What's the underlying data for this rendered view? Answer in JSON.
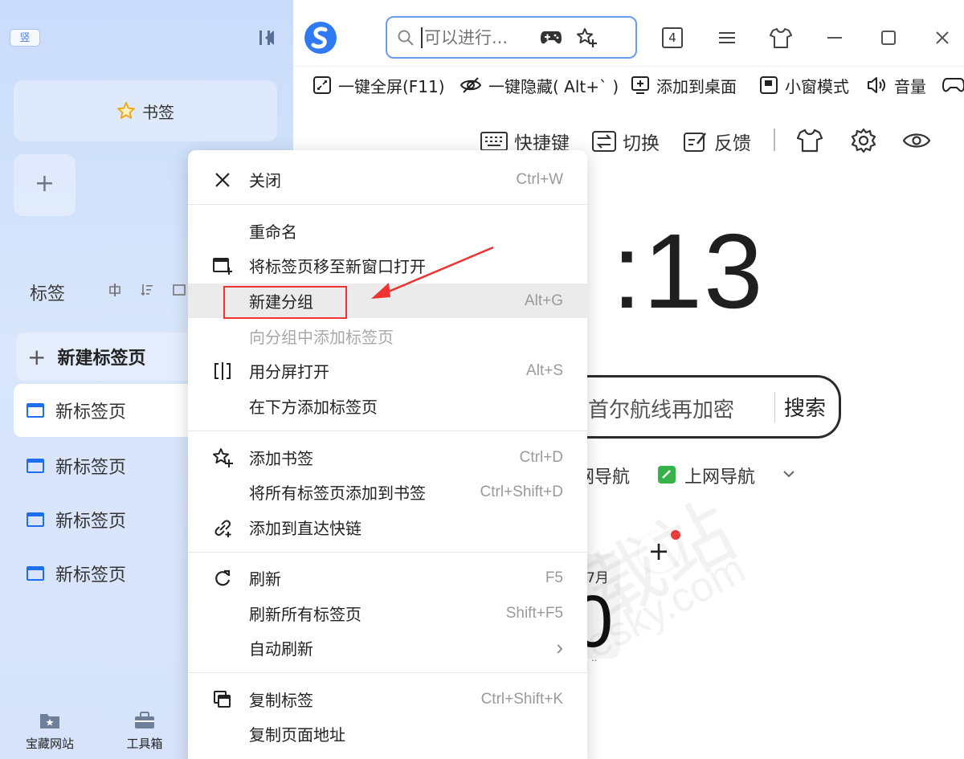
{
  "sidebar": {
    "vertical_tabs_badge": "竖",
    "bookmarks_label": "书签",
    "add_group_label": "+",
    "tabs_label": "标签",
    "new_tab_label": "新建标签页",
    "tabs": [
      {
        "title": "新标签页",
        "active": true
      },
      {
        "title": "新标签页",
        "active": false
      },
      {
        "title": "新标签页",
        "active": false
      },
      {
        "title": "新标签页",
        "active": false
      }
    ],
    "bottom": [
      {
        "label": "宝藏网站",
        "icon": "folder-star-icon"
      },
      {
        "label": "工具箱",
        "icon": "toolbox-icon"
      }
    ]
  },
  "topbar": {
    "search_placeholder": "可以进行...",
    "tab_count": "4"
  },
  "toolbar2": [
    {
      "label": "一键全屏(F11)",
      "icon": "fullscreen-icon"
    },
    {
      "label": "一键隐藏( Alt+` )",
      "icon": "hide-eye-icon"
    },
    {
      "label": "添加到桌面",
      "icon": "add-desktop-icon"
    },
    {
      "label": "小窗模式",
      "icon": "mini-window-icon"
    },
    {
      "label": "音量",
      "icon": "volume-icon"
    }
  ],
  "toolbar3": [
    {
      "label": "快捷键",
      "icon": "keyboard-icon"
    },
    {
      "label": "切换",
      "icon": "switch-icon"
    },
    {
      "label": "反馈",
      "icon": "feedback-icon"
    }
  ],
  "newtab": {
    "clock": ":13",
    "search_text": "首尔航线再加密",
    "search_button": "搜索",
    "nav_partial": "网导航",
    "nav_label": "上网导航",
    "add_site": "+",
    "calendar_month": "7月",
    "calendar_day": "0",
    "calendar_foot": "··"
  },
  "watermark": {
    "text": "天极下载站",
    "url": "mydown.yesky.com"
  },
  "context_menu": {
    "items": [
      {
        "label": "关闭",
        "shortcut": "Ctrl+W",
        "icon": "close-icon"
      },
      {
        "label": "重命名",
        "shortcut": "",
        "icon": ""
      },
      {
        "label": "将标签页移至新窗口打开",
        "shortcut": "",
        "icon": "new-window-icon"
      },
      {
        "label": "新建分组",
        "shortcut": "Alt+G",
        "icon": ""
      },
      {
        "label": "向分组中添加标签页",
        "shortcut": "",
        "icon": ""
      },
      {
        "label": "用分屏打开",
        "shortcut": "Alt+S",
        "icon": "split-screen-icon"
      },
      {
        "label": "在下方添加标签页",
        "shortcut": "",
        "icon": ""
      },
      {
        "label": "添加书签",
        "shortcut": "Ctrl+D",
        "icon": "star-plus-icon"
      },
      {
        "label": "将所有标签页添加到书签",
        "shortcut": "Ctrl+Shift+D",
        "icon": ""
      },
      {
        "label": "添加到直达快链",
        "shortcut": "",
        "icon": "link-plus-icon"
      },
      {
        "label": "刷新",
        "shortcut": "F5",
        "icon": "refresh-icon"
      },
      {
        "label": "刷新所有标签页",
        "shortcut": "Shift+F5",
        "icon": ""
      },
      {
        "label": "自动刷新",
        "shortcut": "›",
        "icon": ""
      },
      {
        "label": "复制标签",
        "shortcut": "Ctrl+Shift+K",
        "icon": "duplicate-icon"
      },
      {
        "label": "复制页面地址",
        "shortcut": "",
        "icon": ""
      }
    ]
  },
  "colors": {
    "accent": "#1d6ff0",
    "highlight_box": "#e33333",
    "sidebar_bg": "#d3e2fb"
  }
}
